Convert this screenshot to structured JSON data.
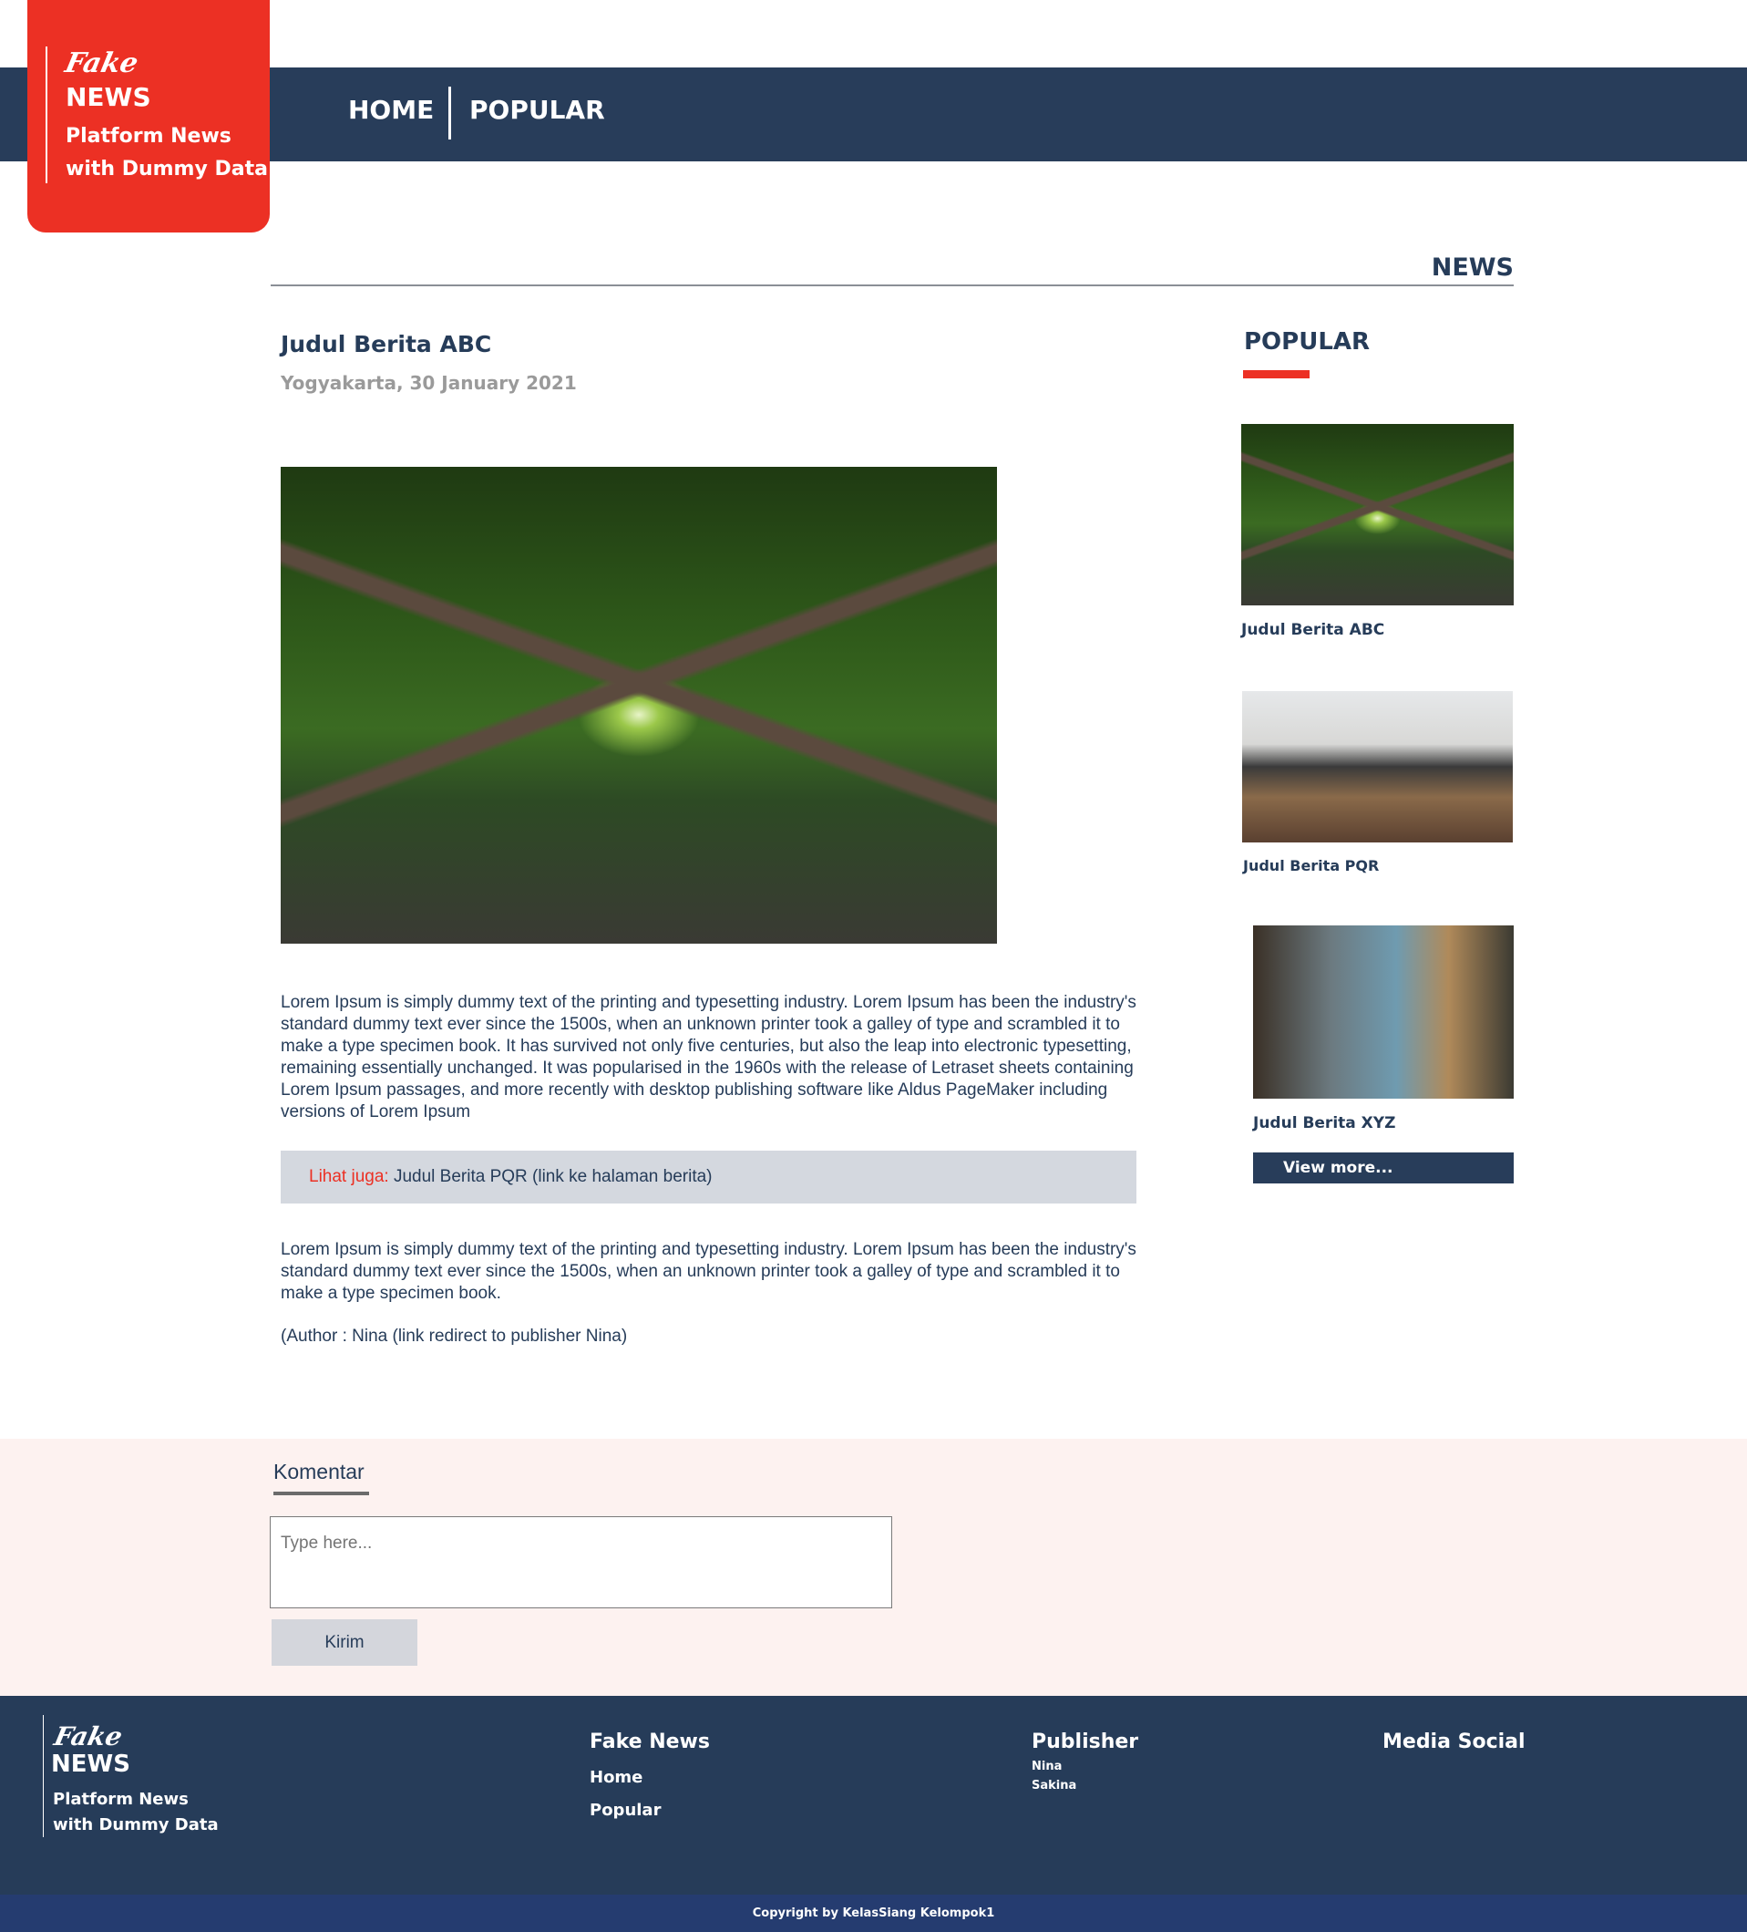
{
  "brand": {
    "script": "Fake",
    "name": "NEWS",
    "tagline1": "Platform News",
    "tagline2": "with Dummy Data"
  },
  "nav": {
    "items": [
      "HOME",
      "POPULAR"
    ]
  },
  "section": {
    "title": "NEWS"
  },
  "article": {
    "title": "Judul Berita ABC",
    "dateline": "Yogyakarta, 30 January 2021",
    "paragraph1": "Lorem Ipsum is simply dummy text of the printing and typesetting industry. Lorem Ipsum has been the industry's standard dummy text ever since the 1500s, when an unknown printer took a galley of type and scrambled it to make a type specimen book. It has survived not only five centuries, but also the leap into electronic typesetting, remaining essentially unchanged. It was popularised in the 1960s with the release of Letraset sheets containing Lorem Ipsum passages, and more recently with desktop publishing software like Aldus PageMaker including versions of Lorem Ipsum",
    "see_also_label": "Lihat juga:",
    "see_also_link": " Judul Berita PQR (link ke halaman berita)",
    "paragraph2": "Lorem Ipsum is simply dummy text of the printing and typesetting industry. Lorem Ipsum has been the industry's standard dummy text ever since the 1500s, when an unknown printer took a galley of type and scrambled it to make a type specimen book.",
    "author": "(Author : Nina (link redirect to publisher Nina)"
  },
  "popular": {
    "title": "POPULAR",
    "items": [
      {
        "title": "Judul Berita ABC"
      },
      {
        "title": "Judul Berita PQR"
      },
      {
        "title": "Judul Berita XYZ"
      }
    ],
    "view_more": "View more..."
  },
  "comments": {
    "title": "Komentar",
    "placeholder": "Type here...",
    "submit": "Kirim"
  },
  "footer": {
    "col1": {
      "title": "Fake News",
      "links": [
        "Home",
        "Popular"
      ]
    },
    "col2": {
      "title": "Publisher",
      "links": [
        "Nina",
        "Sakina"
      ]
    },
    "col3": {
      "title": "Media Social"
    },
    "copyright": "Copyright by KelasSiang Kelompok1"
  },
  "colors": {
    "navy": "#283d5a",
    "red": "#ec3024",
    "comment_bg": "#fdf2f0",
    "copyright_bg": "#253c70"
  }
}
